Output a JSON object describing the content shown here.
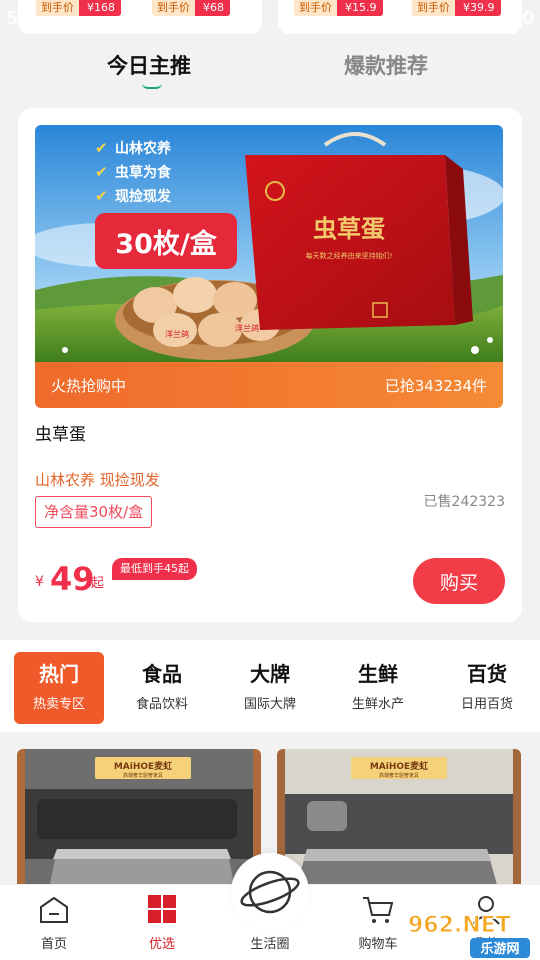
{
  "top_cards": {
    "left": {
      "chips": [
        {
          "label": "到手价",
          "value": "¥168"
        },
        {
          "label": "到手价",
          "value": "¥68"
        }
      ]
    },
    "right": {
      "chips": [
        {
          "label": "到手价",
          "value": "¥15.9"
        },
        {
          "label": "到手价",
          "value": "¥39.9"
        }
      ]
    },
    "edge_left": "5",
    "edge_right": "0"
  },
  "tabs": [
    {
      "label": "今日主推",
      "active": true
    },
    {
      "label": "爆款推荐",
      "active": false
    }
  ],
  "product": {
    "image": {
      "features": [
        "山林农养",
        "虫草为食",
        "现捡现发"
      ],
      "box_label": "30枚/盒",
      "box_title": "虫草蛋",
      "box_tagline": "每天数之经养由来坚持始们!",
      "egg_stamp": "洋兰鸽"
    },
    "flash_left": "火热抢购中",
    "flash_right": "已抢343234件",
    "name": "虫草蛋",
    "desc": "山林农养 现捡现发",
    "spec": "净含量30枚/盒",
    "sold": "已售242323",
    "price_symbol": "¥",
    "price": "49",
    "price_unit": "起",
    "low_badge": "最低到手45起",
    "buy_label": "购买"
  },
  "categories": [
    {
      "title": "热门",
      "sub": "热卖专区",
      "active": true
    },
    {
      "title": "食品",
      "sub": "食品饮料",
      "active": false
    },
    {
      "title": "大牌",
      "sub": "国际大牌",
      "active": false
    },
    {
      "title": "生鲜",
      "sub": "生鲜水产",
      "active": false
    },
    {
      "title": "百货",
      "sub": "日用百货",
      "active": false
    }
  ],
  "brand_tag": "MAiHOE麦虹",
  "brand_sub": "高端奢华轻奢家具",
  "nav": [
    {
      "label": "首页",
      "icon": "home-icon",
      "active": false
    },
    {
      "label": "优选",
      "icon": "grid-icon",
      "active": true
    },
    {
      "label": "生活圈",
      "icon": "planet-icon",
      "active": false
    },
    {
      "label": "购物车",
      "icon": "cart-icon",
      "active": false
    },
    {
      "label": "我的",
      "icon": "user-icon",
      "active": false
    }
  ],
  "watermark": {
    "top": "962.NET",
    "bottom": "乐游网"
  },
  "colors": {
    "accent": "#f0304b",
    "orange": "#f05a2a",
    "green": "#1ba57a",
    "nav_active": "#d8202a"
  }
}
